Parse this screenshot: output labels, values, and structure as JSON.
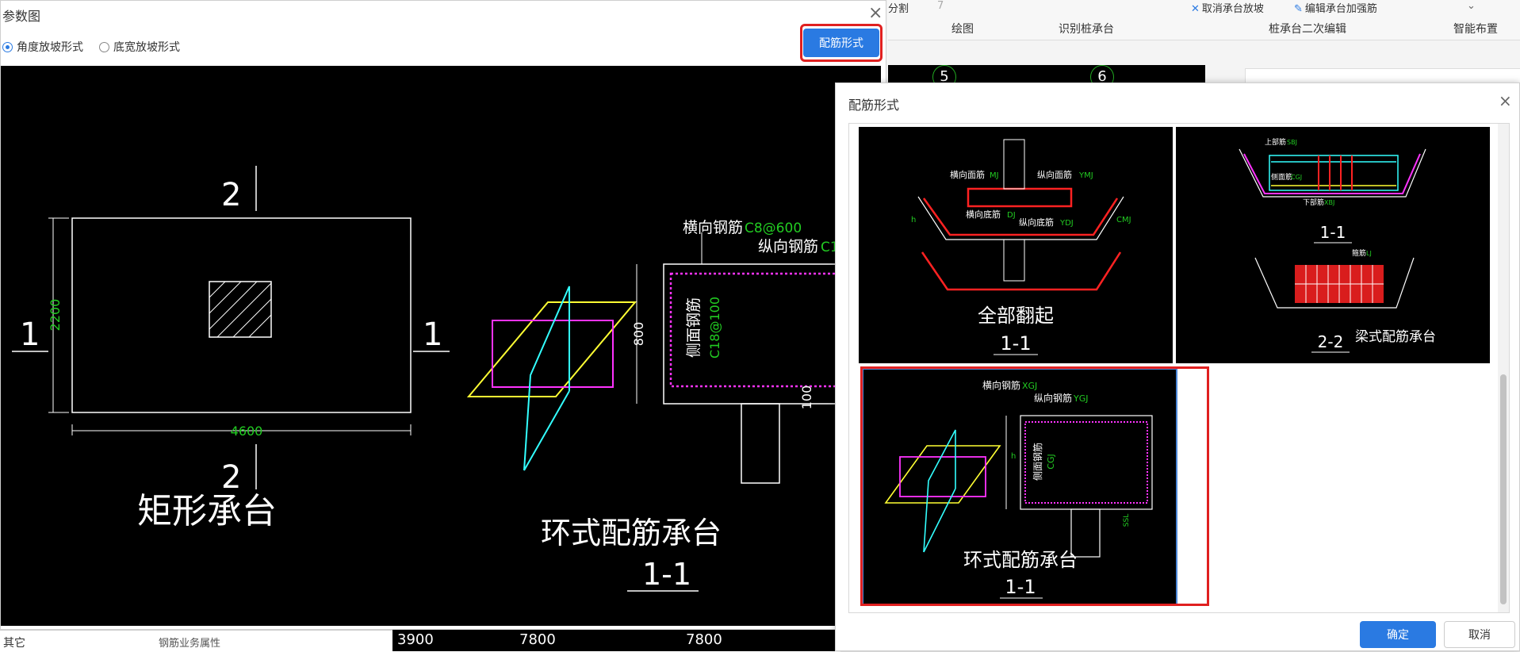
{
  "background": {
    "ribbon": {
      "top_items": [
        "分割",
        "7",
        "取消承台放坡",
        "编辑承台加强筋"
      ],
      "groups": [
        "绘图",
        "识别桩承台",
        "桩承台二次编辑",
        "智能布置"
      ]
    },
    "axis_labels": [
      "5",
      "6"
    ],
    "bottom": {
      "left_text": "其它",
      "sub_text": "钢筋业务属性",
      "dims": [
        "3900",
        "7800",
        "7800"
      ]
    }
  },
  "param_dialog": {
    "title": "参数图",
    "radio_angle": "角度放坡形式",
    "radio_width": "底宽放坡形式",
    "rebar_button": "配筋形式",
    "drawing": {
      "title": "矩形承台",
      "dim_height": "2200",
      "dim_width": "4600",
      "marks": [
        "2",
        "2",
        "1",
        "1"
      ],
      "section_title": "环式配筋承台",
      "section_label": "1-1",
      "transverse": "横向钢筋",
      "transverse_val": "C8@600",
      "longitudinal": "纵向钢筋",
      "longitudinal_val": "C1",
      "side": "侧面钢筋",
      "side_val": "C18@100",
      "dim_800": "800",
      "dim_100": "100"
    }
  },
  "rebar_dialog": {
    "title": "配筋形式",
    "opt1": {
      "caption": "全部翻起",
      "label": "1-1",
      "texts": [
        "横向面筋",
        "MJ",
        "纵向面筋",
        "YMJ",
        "横向底筋",
        "DJ",
        "纵向底筋",
        "YDJ",
        "CMJ",
        "h"
      ]
    },
    "opt2": {
      "caption": "梁式配筋承台",
      "label1": "1-1",
      "label2": "2-2",
      "texts": [
        "上部筋",
        "SBJ",
        "侧面筋",
        "CGJ",
        "下部筋",
        "XBJ",
        "箍筋",
        "LJ"
      ]
    },
    "opt3": {
      "caption": "环式配筋承台",
      "label": "1-1",
      "texts": [
        "横向钢筋",
        "XGJ",
        "纵向钢筋",
        "YGJ",
        "侧面钢筋",
        "CGJ",
        "h",
        "SSL"
      ]
    },
    "ok_button": "确定",
    "cancel_button": "取消"
  },
  "colors": {
    "accent": "#2a7ae2",
    "highlight": "#e02020",
    "cad_green": "#22cc22",
    "cad_yellow": "#ffff33",
    "cad_magenta": "#ff33ff",
    "cad_cyan": "#33ffff",
    "cad_red": "#ff2222"
  }
}
